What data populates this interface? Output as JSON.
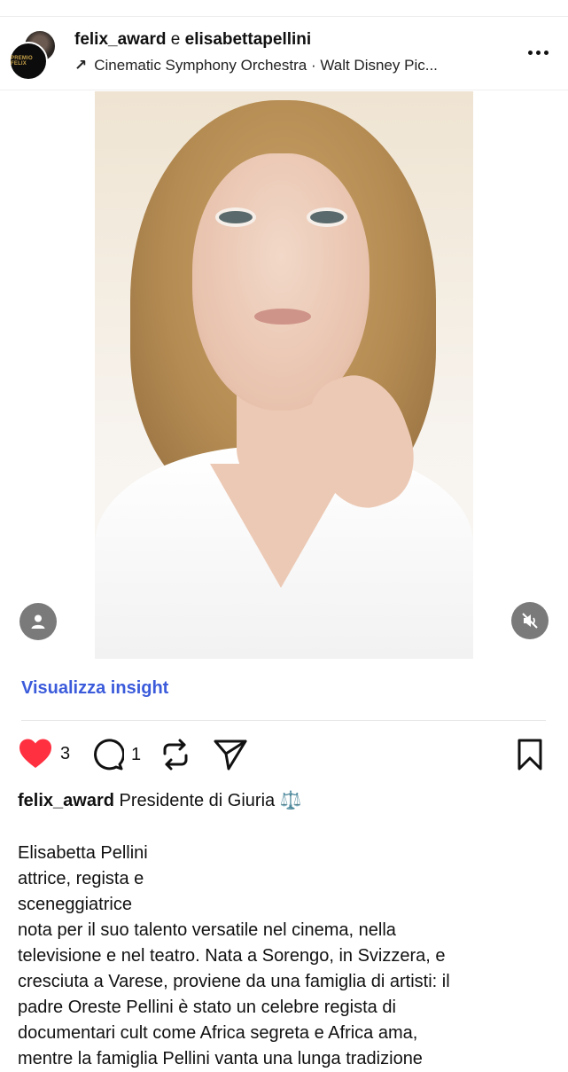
{
  "header": {
    "user_primary": "felix_award",
    "joiner": " e ",
    "user_secondary": "elisabettapellini",
    "audio_label": "Cinematic Symphony Orchestra · Walt Disney Pic...",
    "avatar_text": "PREMIO FELIX"
  },
  "post": {
    "photo_subject": "portrait of woman with blonde hair in white blouse"
  },
  "insights_label": "Visualizza insight",
  "actions": {
    "likes": "3",
    "comments": "1"
  },
  "caption": {
    "username": "felix_award",
    "headline": " Presidente di Giuria ⚖️",
    "lines": [
      "Elisabetta Pellini",
      "attrice, regista e",
      "sceneggiatrice",
      "nota per il suo talento versatile nel cinema, nella",
      "televisione e nel teatro. Nata a Sorengo, in Svizzera, e",
      "cresciuta a Varese, proviene da una famiglia di artisti: il",
      "padre Oreste Pellini è stato un celebre regista di",
      "documentari cult come Africa segreta e Africa ama,",
      "mentre la famiglia Pellini vanta una lunga tradizione"
    ]
  },
  "colors": {
    "link": "#3b5bdb",
    "heart": "#ff3040",
    "overlay_button": "#7a7a7a"
  },
  "icons": [
    "more-icon",
    "arrow-up-right-icon",
    "person-icon",
    "mute-icon",
    "heart-icon",
    "comment-icon",
    "repost-icon",
    "share-icon",
    "bookmark-icon"
  ]
}
